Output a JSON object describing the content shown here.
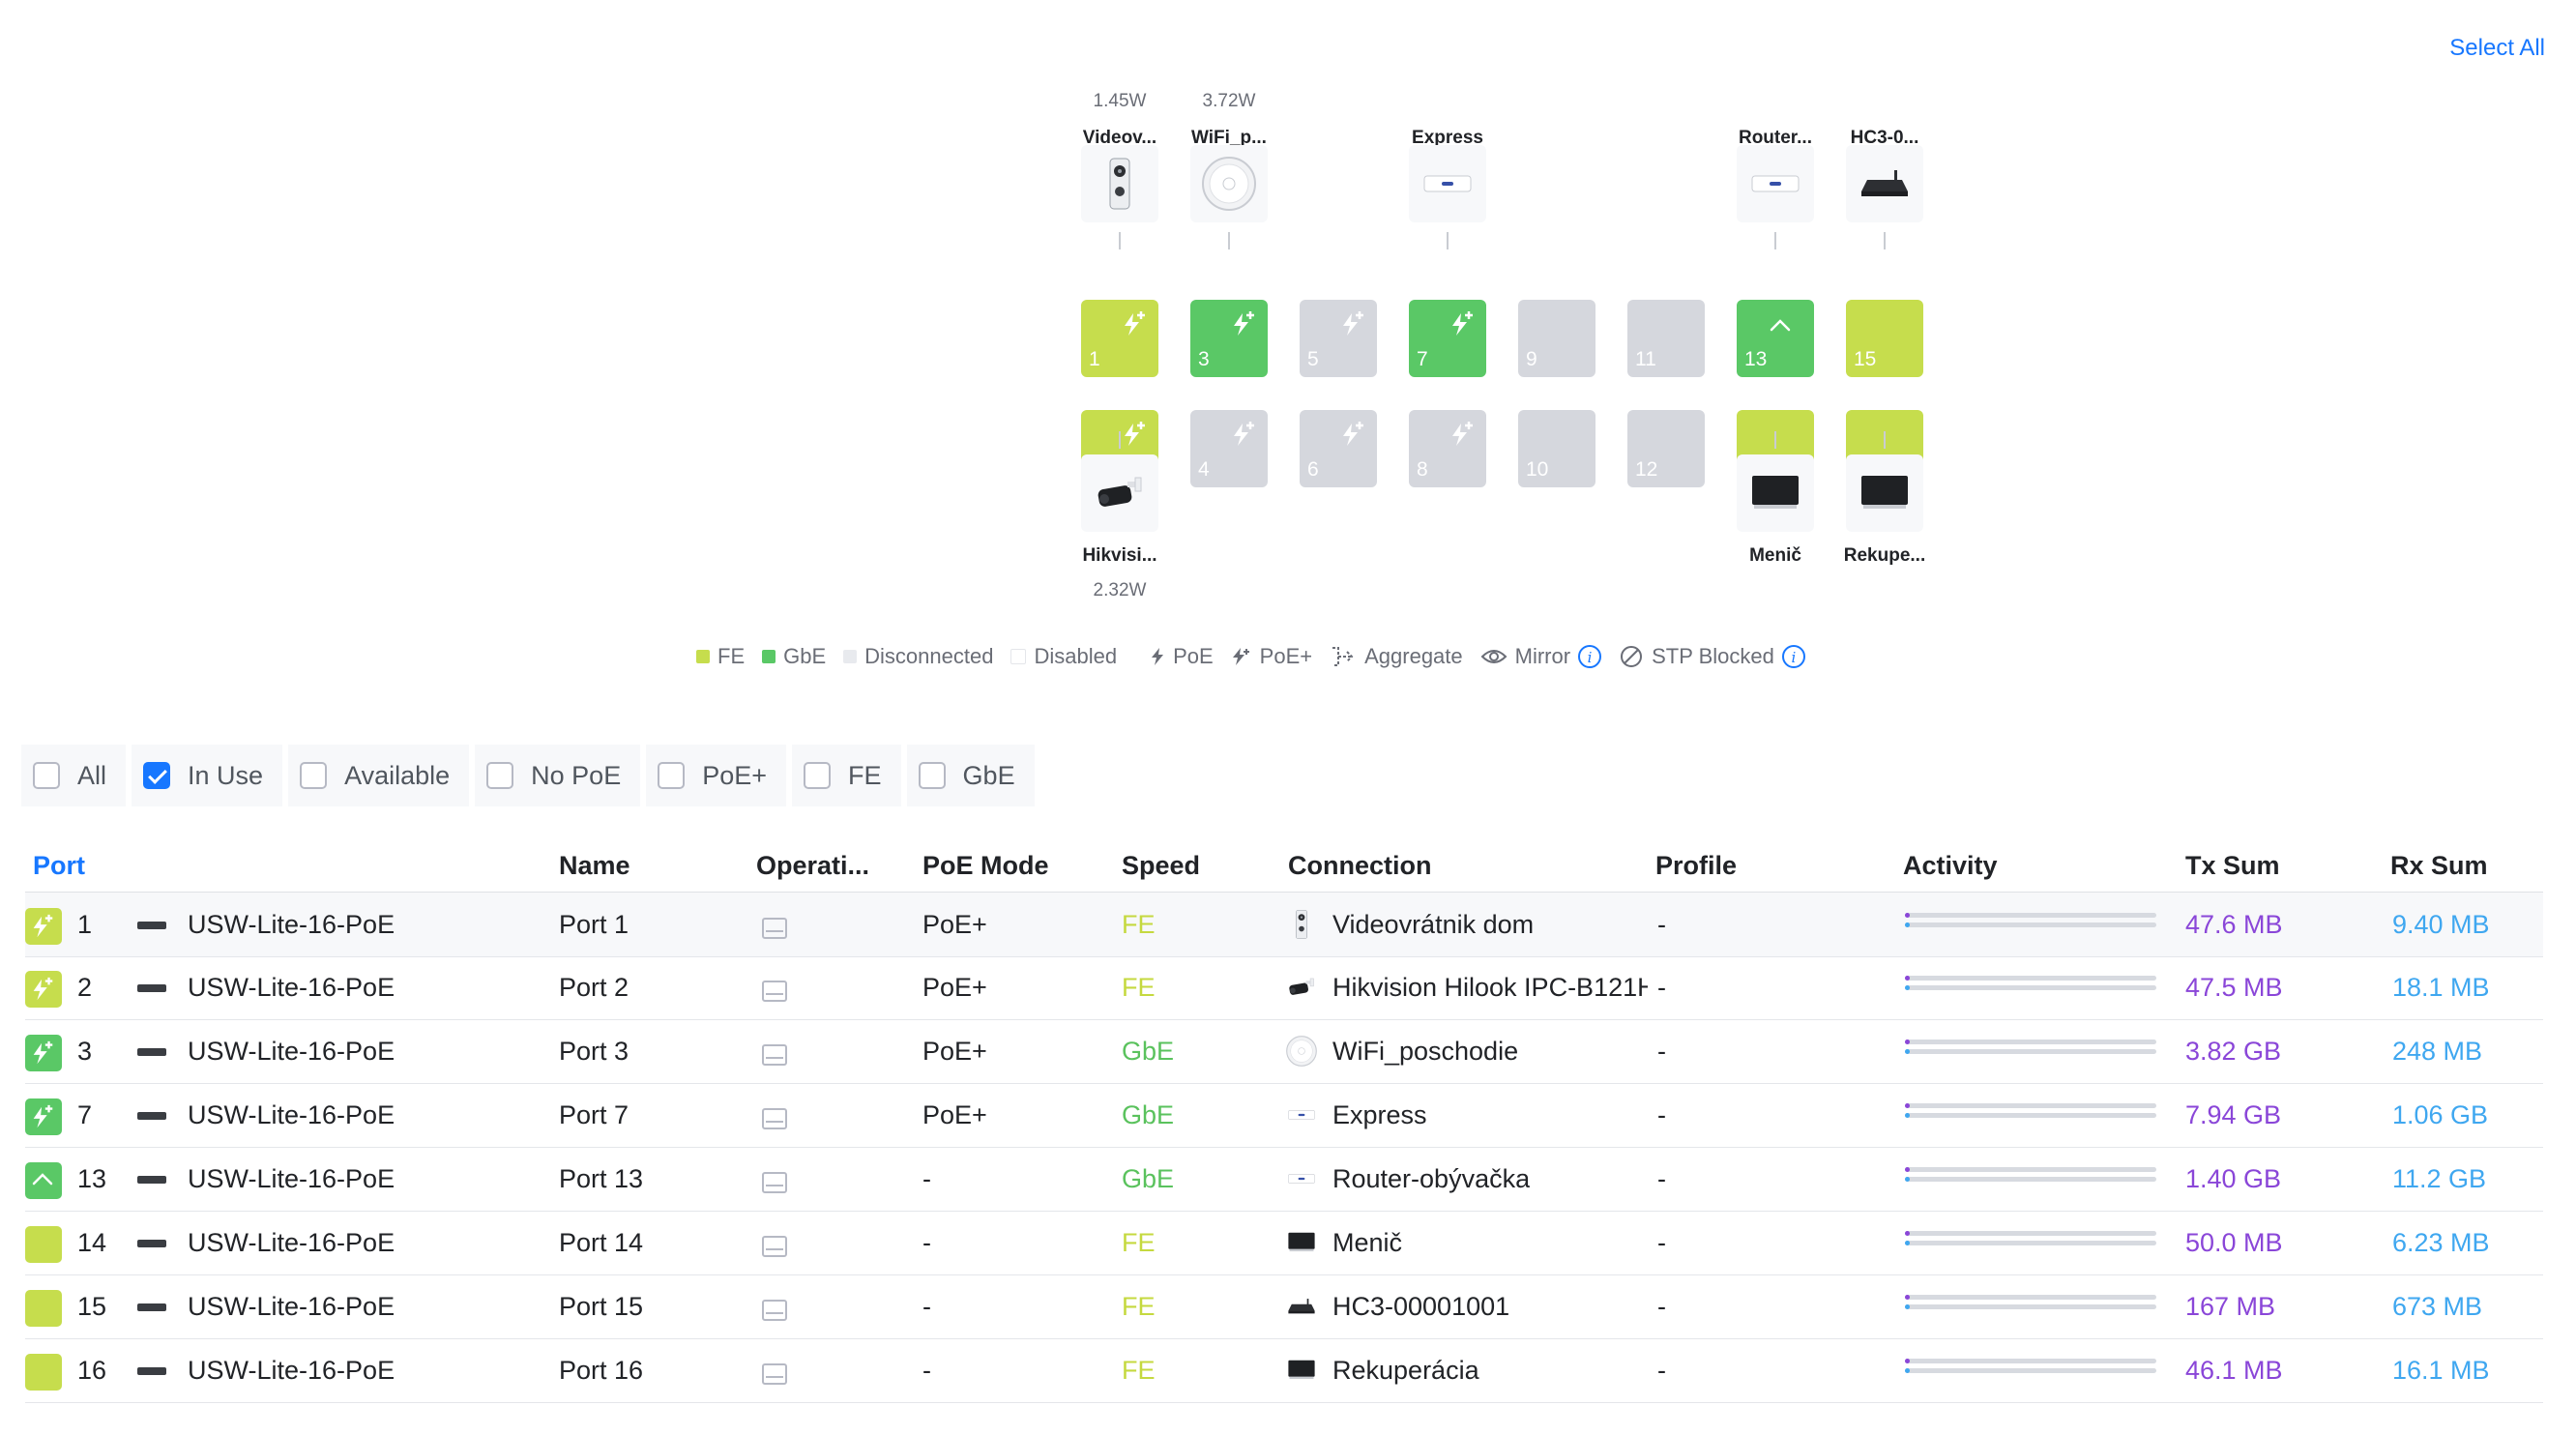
{
  "header": {
    "select_all": "Select All"
  },
  "colors": {
    "fe": "#c6dd4d",
    "gbe": "#5ac866",
    "disconnected": "#d3d5db",
    "accent": "#1777ff",
    "tx": "#8a46d8",
    "rx": "#3fa7f0"
  },
  "port_map": {
    "top_devices": [
      {
        "port": 1,
        "power": "1.45W",
        "name": "Videov...",
        "icon": "doorbell-icon"
      },
      {
        "port": 3,
        "power": "3.72W",
        "name": "WiFi_p...",
        "icon": "access-point-icon"
      },
      {
        "port": 7,
        "power": "",
        "name": "Express",
        "icon": "gateway-icon"
      },
      {
        "port": 13,
        "power": "",
        "name": "Router...",
        "icon": "gateway-icon"
      },
      {
        "port": 15,
        "power": "",
        "name": "HC3-0...",
        "icon": "controller-icon"
      }
    ],
    "bottom_devices": [
      {
        "port": 2,
        "power": "2.32W",
        "name": "Hikvisi...",
        "icon": "bullet-camera-icon"
      },
      {
        "port": 14,
        "power": "",
        "name": "Menič",
        "icon": "monitor-icon"
      },
      {
        "port": 16,
        "power": "",
        "name": "Rekupe...",
        "icon": "monitor-icon"
      }
    ],
    "ports": [
      {
        "n": "1",
        "state": "fe",
        "icon": "poe-plus"
      },
      {
        "n": "2",
        "state": "fe",
        "icon": "poe-plus"
      },
      {
        "n": "3",
        "state": "gbe",
        "icon": "poe-plus"
      },
      {
        "n": "4",
        "state": "disconnected",
        "icon": "poe-plus"
      },
      {
        "n": "5",
        "state": "disconnected",
        "icon": "poe-plus"
      },
      {
        "n": "6",
        "state": "disconnected",
        "icon": "poe-plus"
      },
      {
        "n": "7",
        "state": "gbe",
        "icon": "poe-plus"
      },
      {
        "n": "8",
        "state": "disconnected",
        "icon": "poe-plus"
      },
      {
        "n": "9",
        "state": "disconnected",
        "icon": ""
      },
      {
        "n": "10",
        "state": "disconnected",
        "icon": ""
      },
      {
        "n": "11",
        "state": "disconnected",
        "icon": ""
      },
      {
        "n": "12",
        "state": "disconnected",
        "icon": ""
      },
      {
        "n": "13",
        "state": "gbe",
        "icon": "uplink"
      },
      {
        "n": "14",
        "state": "fe",
        "icon": ""
      },
      {
        "n": "15",
        "state": "fe",
        "icon": ""
      },
      {
        "n": "16",
        "state": "fe",
        "icon": ""
      }
    ]
  },
  "legend": {
    "fe": "FE",
    "gbe": "GbE",
    "disconnected": "Disconnected",
    "disabled": "Disabled",
    "poe": "PoE",
    "poe_plus": "PoE+",
    "aggregate": "Aggregate",
    "mirror": "Mirror",
    "stp_blocked": "STP Blocked"
  },
  "filters": [
    {
      "label": "All",
      "checked": false
    },
    {
      "label": "In Use",
      "checked": true
    },
    {
      "label": "Available",
      "checked": false
    },
    {
      "label": "No PoE",
      "checked": false
    },
    {
      "label": "PoE+",
      "checked": false
    },
    {
      "label": "FE",
      "checked": false
    },
    {
      "label": "GbE",
      "checked": false
    }
  ],
  "table": {
    "columns": {
      "port": "Port",
      "name": "Name",
      "operation": "Operati...",
      "poe_mode": "PoE Mode",
      "speed": "Speed",
      "connection": "Connection",
      "profile": "Profile",
      "activity": "Activity",
      "tx_sum": "Tx Sum",
      "rx_sum": "Rx Sum"
    },
    "rows": [
      {
        "port": "1",
        "state": "fe",
        "icon": "poe-plus",
        "device": "USW-Lite-16-PoE",
        "name": "Port 1",
        "poe_mode": "PoE+",
        "speed": "FE",
        "connection": "Videovrátnik dom",
        "conn_icon": "doorbell-icon",
        "profile": "-",
        "tx_share": 0.02,
        "tx": "47.6 MB",
        "rx": "9.40 MB"
      },
      {
        "port": "2",
        "state": "fe",
        "icon": "poe-plus",
        "device": "USW-Lite-16-PoE",
        "name": "Port 2",
        "poe_mode": "PoE+",
        "speed": "FE",
        "connection": "Hikvision Hilook IPC-B121H",
        "conn_icon": "bullet-camera-icon",
        "profile": "-",
        "tx_share": 0.02,
        "tx": "47.5 MB",
        "rx": "18.1 MB"
      },
      {
        "port": "3",
        "state": "gbe",
        "icon": "poe-plus",
        "device": "USW-Lite-16-PoE",
        "name": "Port 3",
        "poe_mode": "PoE+",
        "speed": "GbE",
        "connection": "WiFi_poschodie",
        "conn_icon": "access-point-icon",
        "profile": "-",
        "tx_share": 0.02,
        "tx": "3.82 GB",
        "rx": "248 MB"
      },
      {
        "port": "7",
        "state": "gbe",
        "icon": "poe-plus",
        "device": "USW-Lite-16-PoE",
        "name": "Port 7",
        "poe_mode": "PoE+",
        "speed": "GbE",
        "connection": "Express",
        "conn_icon": "gateway-icon",
        "profile": "-",
        "tx_share": 0.02,
        "tx": "7.94 GB",
        "rx": "1.06 GB"
      },
      {
        "port": "13",
        "state": "gbe",
        "icon": "uplink",
        "device": "USW-Lite-16-PoE",
        "name": "Port 13",
        "poe_mode": "-",
        "speed": "GbE",
        "connection": "Router-obývačka",
        "conn_icon": "gateway-icon",
        "profile": "-",
        "tx_share": 0.02,
        "tx": "1.40 GB",
        "rx": "11.2 GB"
      },
      {
        "port": "14",
        "state": "fe",
        "icon": "",
        "device": "USW-Lite-16-PoE",
        "name": "Port 14",
        "poe_mode": "-",
        "speed": "FE",
        "connection": "Menič",
        "conn_icon": "monitor-icon",
        "profile": "-",
        "tx_share": 0.02,
        "tx": "50.0 MB",
        "rx": "6.23 MB"
      },
      {
        "port": "15",
        "state": "fe",
        "icon": "",
        "device": "USW-Lite-16-PoE",
        "name": "Port 15",
        "poe_mode": "-",
        "speed": "FE",
        "connection": "HC3-00001001",
        "conn_icon": "controller-icon",
        "profile": "-",
        "tx_share": 0.02,
        "tx": "167 MB",
        "rx": "673 MB"
      },
      {
        "port": "16",
        "state": "fe",
        "icon": "",
        "device": "USW-Lite-16-PoE",
        "name": "Port 16",
        "poe_mode": "-",
        "speed": "FE",
        "connection": "Rekuperácia",
        "conn_icon": "monitor-icon",
        "profile": "-",
        "tx_share": 0.02,
        "tx": "46.1 MB",
        "rx": "16.1 MB"
      }
    ]
  }
}
